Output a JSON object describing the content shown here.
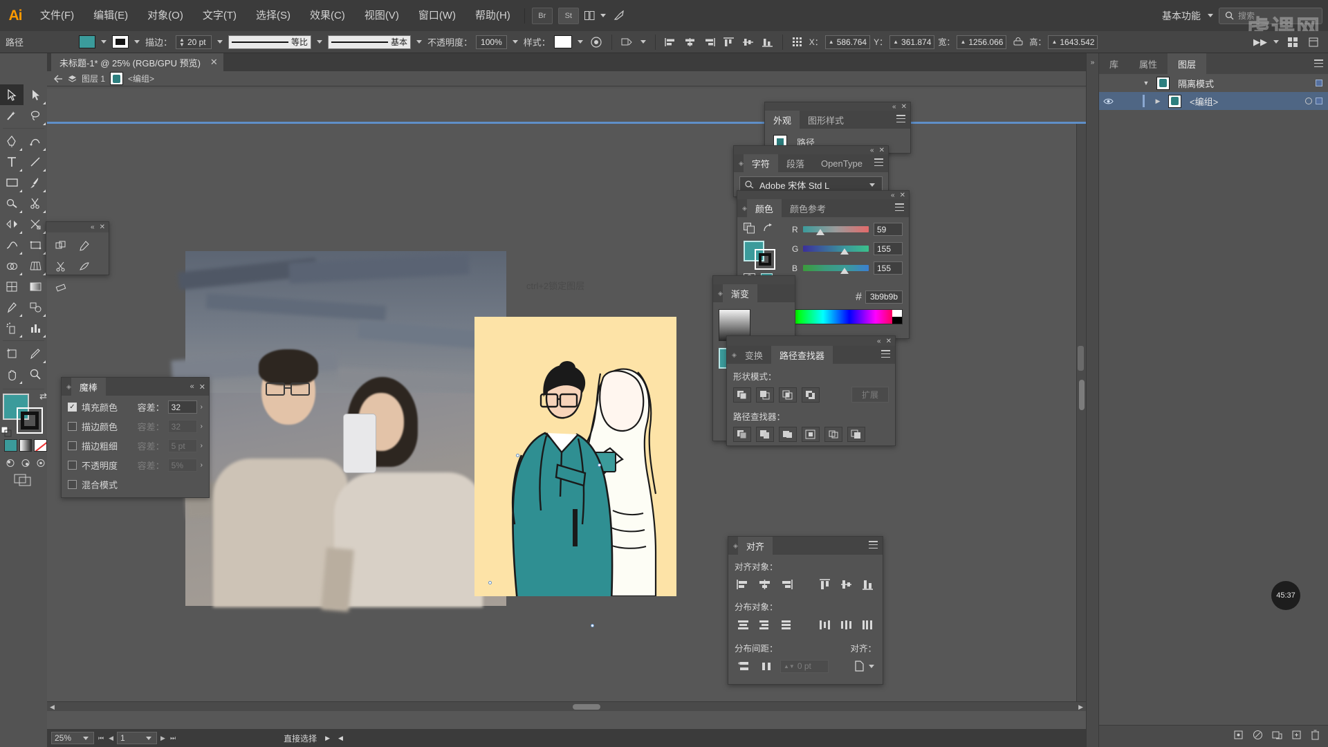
{
  "app": {
    "name": "Adobe Illustrator",
    "logo": "Ai"
  },
  "menubar": {
    "items": [
      {
        "label": "文件(F)"
      },
      {
        "label": "编辑(E)"
      },
      {
        "label": "对象(O)"
      },
      {
        "label": "文字(T)"
      },
      {
        "label": "选择(S)"
      },
      {
        "label": "效果(C)"
      },
      {
        "label": "视图(V)"
      },
      {
        "label": "窗口(W)"
      },
      {
        "label": "帮助(H)"
      }
    ],
    "bridge_label": "Br",
    "stock_label": "St",
    "workspace": "基本功能",
    "search_placeholder": "搜索",
    "watermark": "虎课网"
  },
  "controlbar": {
    "object_label": "路径",
    "fill_color": "#3b9b9b",
    "stroke_color": "#ffffff",
    "stroke_label": "描边：",
    "stroke_weight": "20 pt",
    "profile_label": "等比",
    "brush_label": "基本",
    "opacity_label": "不透明度：",
    "opacity_value": "100%",
    "style_label": "样式：",
    "x_label": "X：",
    "x_value": "586.764",
    "y_label": "Y：",
    "y_value": "361.874",
    "w_label": "宽：",
    "w_value": "1256.066",
    "h_label": "高：",
    "h_value": "1643.542"
  },
  "document": {
    "tab_title": "未标题-1* @ 25% (RGB/GPU 预览)",
    "breadcrumb_layer": "图层 1",
    "breadcrumb_group": "<编组>",
    "canvas_annotation": "ctrl+2锁定图层"
  },
  "statusbar": {
    "zoom": "25%",
    "page": "1",
    "tool_status": "直接选择"
  },
  "panels": {
    "magic_wand": {
      "tab": "魔棒",
      "rows": [
        {
          "label": "填充颜色",
          "checked": true,
          "tol_label": "容差：",
          "tol_value": "32",
          "enabled": true
        },
        {
          "label": "描边颜色",
          "checked": false,
          "tol_label": "容差：",
          "tol_value": "32",
          "enabled": false
        },
        {
          "label": "描边粗细",
          "checked": false,
          "tol_label": "容差：",
          "tol_value": "5 pt",
          "enabled": false
        },
        {
          "label": "不透明度",
          "checked": false,
          "tol_label": "容差：",
          "tol_value": "5%",
          "enabled": false
        },
        {
          "label": "混合模式",
          "checked": false,
          "tol_label": "",
          "tol_value": "",
          "enabled": false
        }
      ]
    },
    "appearance": {
      "tabs": [
        "外观",
        "图形样式"
      ],
      "active_tab": "外观",
      "item_label": "路径"
    },
    "character": {
      "tabs": [
        "字符",
        "段落",
        "OpenType"
      ],
      "active_tab": "字符",
      "font_family": "Adobe 宋体 Std L"
    },
    "color": {
      "tabs": [
        "颜色",
        "颜色参考"
      ],
      "active_tab": "颜色",
      "channels": [
        {
          "label": "R",
          "value": "59",
          "pct": 23
        },
        {
          "label": "G",
          "value": "155",
          "pct": 61
        },
        {
          "label": "B",
          "value": "155",
          "pct": 61
        }
      ],
      "hex_label": "#",
      "hex_value": "3b9b9b",
      "current_color": "#3b9b9b"
    },
    "gradient": {
      "tab": "渐变"
    },
    "pathfinder": {
      "tabs": [
        "变换",
        "路径查找器"
      ],
      "active_tab": "路径查找器",
      "shape_modes_label": "形状模式：",
      "expand_label": "扩展",
      "pathfinders_label": "路径查找器："
    },
    "align": {
      "tab": "对齐",
      "align_objects_label": "对齐对象：",
      "distribute_objects_label": "分布对象：",
      "distribute_spacing_label": "分布间距：",
      "align_to_label": "对齐：",
      "spacing_value": "0 pt"
    }
  },
  "dock": {
    "tabs": [
      "库",
      "属性",
      "图层"
    ],
    "active_tab": "图层",
    "layers": [
      {
        "name": "隔离模式",
        "selected": false,
        "visible": false,
        "expanded": true
      },
      {
        "name": "<编组>",
        "selected": true,
        "visible": true,
        "expanded": false
      }
    ]
  },
  "timer": {
    "value": "45:37"
  }
}
